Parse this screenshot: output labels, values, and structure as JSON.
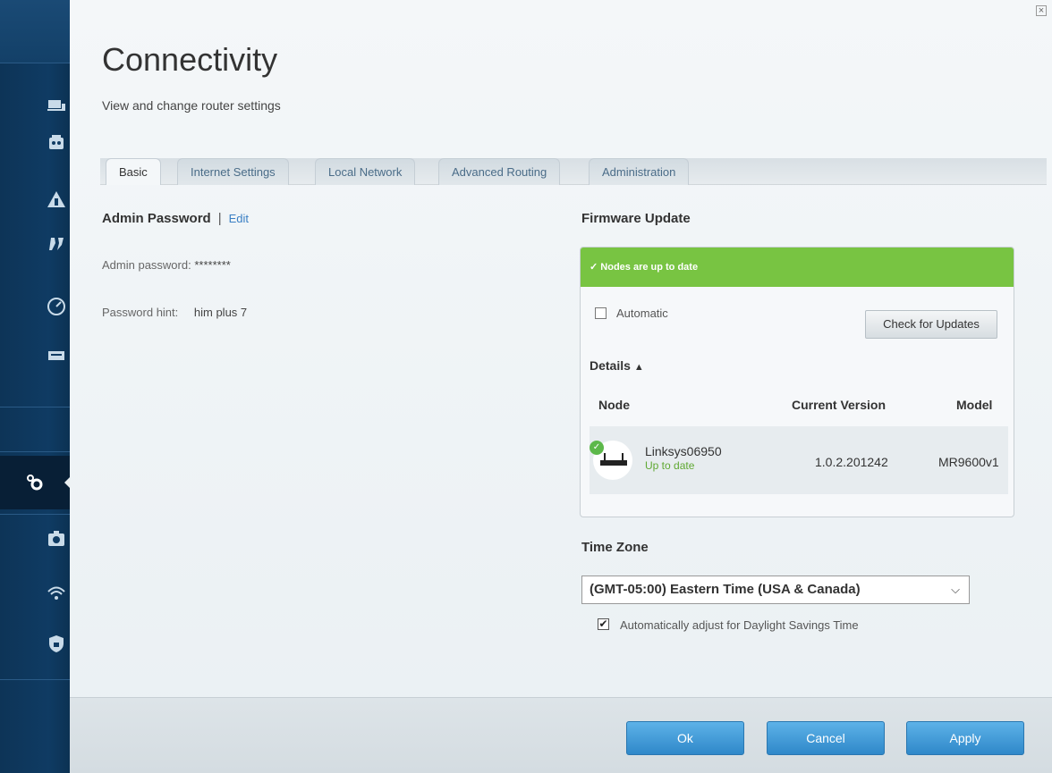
{
  "page": {
    "title": "Connectivity",
    "subtitle": "View and change router settings"
  },
  "sidebar": {
    "icons": [
      "devices-icon",
      "parental-controls-icon",
      "guest-access-icon",
      "media-prioritization-icon",
      "speed-test-icon",
      "external-storage-icon",
      "connectivity-gear-icon",
      "troubleshooting-icon",
      "wireless-icon",
      "security-icon"
    ]
  },
  "tabs": [
    {
      "label": "Basic",
      "active": true
    },
    {
      "label": "Internet Settings",
      "active": false
    },
    {
      "label": "Local Network",
      "active": false
    },
    {
      "label": "Advanced Routing",
      "active": false
    },
    {
      "label": "Administration",
      "active": false
    }
  ],
  "admin": {
    "title": "Admin Password",
    "separator": "|",
    "edit": "Edit",
    "password_label": "Admin password:",
    "password_value": "********",
    "hint_label": "Password hint:",
    "hint_value": "him plus 7"
  },
  "firmware": {
    "title": "Firmware Update",
    "status": "Nodes are up to date",
    "automatic_label": "Automatic",
    "automatic_checked": false,
    "check_button": "Check for Updates",
    "details_label": "Details",
    "columns": {
      "node": "Node",
      "version": "Current Version",
      "model": "Model"
    },
    "nodes": [
      {
        "name": "Linksys06950",
        "status": "Up to date",
        "version": "1.0.2.201242",
        "model": "MR9600v1"
      }
    ]
  },
  "timezone": {
    "title": "Time Zone",
    "selected": "(GMT-05:00) Eastern Time (USA & Canada)",
    "dst_label": "Automatically adjust for Daylight Savings Time",
    "dst_checked": true
  },
  "footer": {
    "ok": "Ok",
    "cancel": "Cancel",
    "apply": "Apply"
  },
  "colors": {
    "sidebar": "#0f3b63",
    "status_green": "#78c442",
    "button_blue": "#3a93d4",
    "link_blue": "#3a7fc4"
  }
}
